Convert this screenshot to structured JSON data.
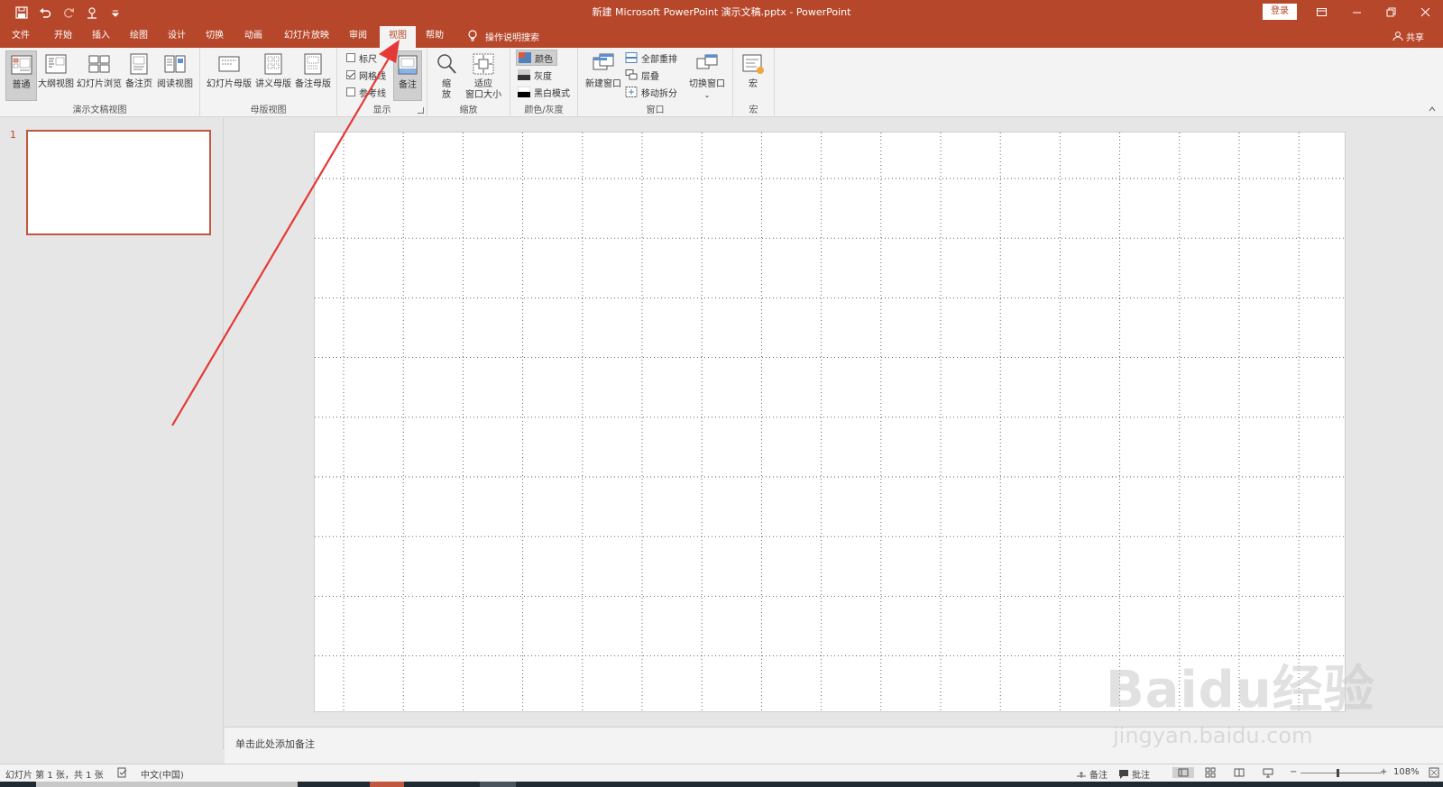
{
  "colors": {
    "accent": "#b7472a",
    "ribbon_bg": "#f3f3f3",
    "canvas_bg": "#e6e6e6",
    "slide_border": "#c0573e",
    "arrow": "#e53935"
  },
  "window": {
    "title": "新建 Microsoft PowerPoint 演示文稿.pptx  -  PowerPoint",
    "login_label": "登录",
    "share_label": "共享",
    "quick_access": [
      "save-icon",
      "undo-icon",
      "redo-icon",
      "touch-mode-icon",
      "customize-icon"
    ],
    "controls": [
      "ribbon-display-icon",
      "minimize-icon",
      "restore-icon",
      "close-icon"
    ]
  },
  "tabs": [
    {
      "label": "文件"
    },
    {
      "label": "开始"
    },
    {
      "label": "插入"
    },
    {
      "label": "绘图"
    },
    {
      "label": "设计"
    },
    {
      "label": "切换"
    },
    {
      "label": "动画"
    },
    {
      "label": "幻灯片放映"
    },
    {
      "label": "审阅"
    },
    {
      "label": "视图",
      "active": true
    },
    {
      "label": "帮助"
    }
  ],
  "tell_me": "操作说明搜索",
  "ribbon": {
    "presentation_views": {
      "label": "演示文稿视图",
      "buttons": [
        {
          "label": "普通",
          "pressed": true
        },
        {
          "label": "大纲视图"
        },
        {
          "label": "幻灯片浏览"
        },
        {
          "label": "备注页"
        },
        {
          "label": "阅读视图"
        }
      ]
    },
    "master_views": {
      "label": "母版视图",
      "buttons": [
        {
          "label": "幻灯片母版"
        },
        {
          "label": "讲义母版"
        },
        {
          "label": "备注母版"
        }
      ]
    },
    "show": {
      "label": "显示",
      "checks": [
        {
          "label": "标尺",
          "checked": false
        },
        {
          "label": "网格线",
          "checked": true
        },
        {
          "label": "参考线",
          "checked": false
        }
      ],
      "notes_button": "备注"
    },
    "zoom": {
      "label": "缩放",
      "zoom_line1": "缩",
      "zoom_line2": "放",
      "fit_line1": "适应",
      "fit_line2": "窗口大小"
    },
    "color": {
      "label": "颜色/灰度",
      "options": [
        {
          "label": "颜色",
          "selected": true
        },
        {
          "label": "灰度"
        },
        {
          "label": "黑白模式"
        }
      ]
    },
    "window": {
      "label": "窗口",
      "new_window": "新建窗口",
      "arrange": [
        "全部重排",
        "层叠",
        "移动拆分"
      ],
      "switch": "切换窗口"
    },
    "macros": {
      "label": "宏",
      "button": "宏"
    }
  },
  "slides": [
    {
      "number": "1"
    }
  ],
  "notes_placeholder": "单击此处添加备注",
  "status": {
    "slide_info": "幻灯片 第 1 张，共 1 张",
    "language": "中文(中国)",
    "notes": "备注",
    "comments": "批注",
    "zoom": "108%"
  },
  "watermark": {
    "logo": "Baidu经验",
    "url": "jingyan.baidu.com"
  }
}
